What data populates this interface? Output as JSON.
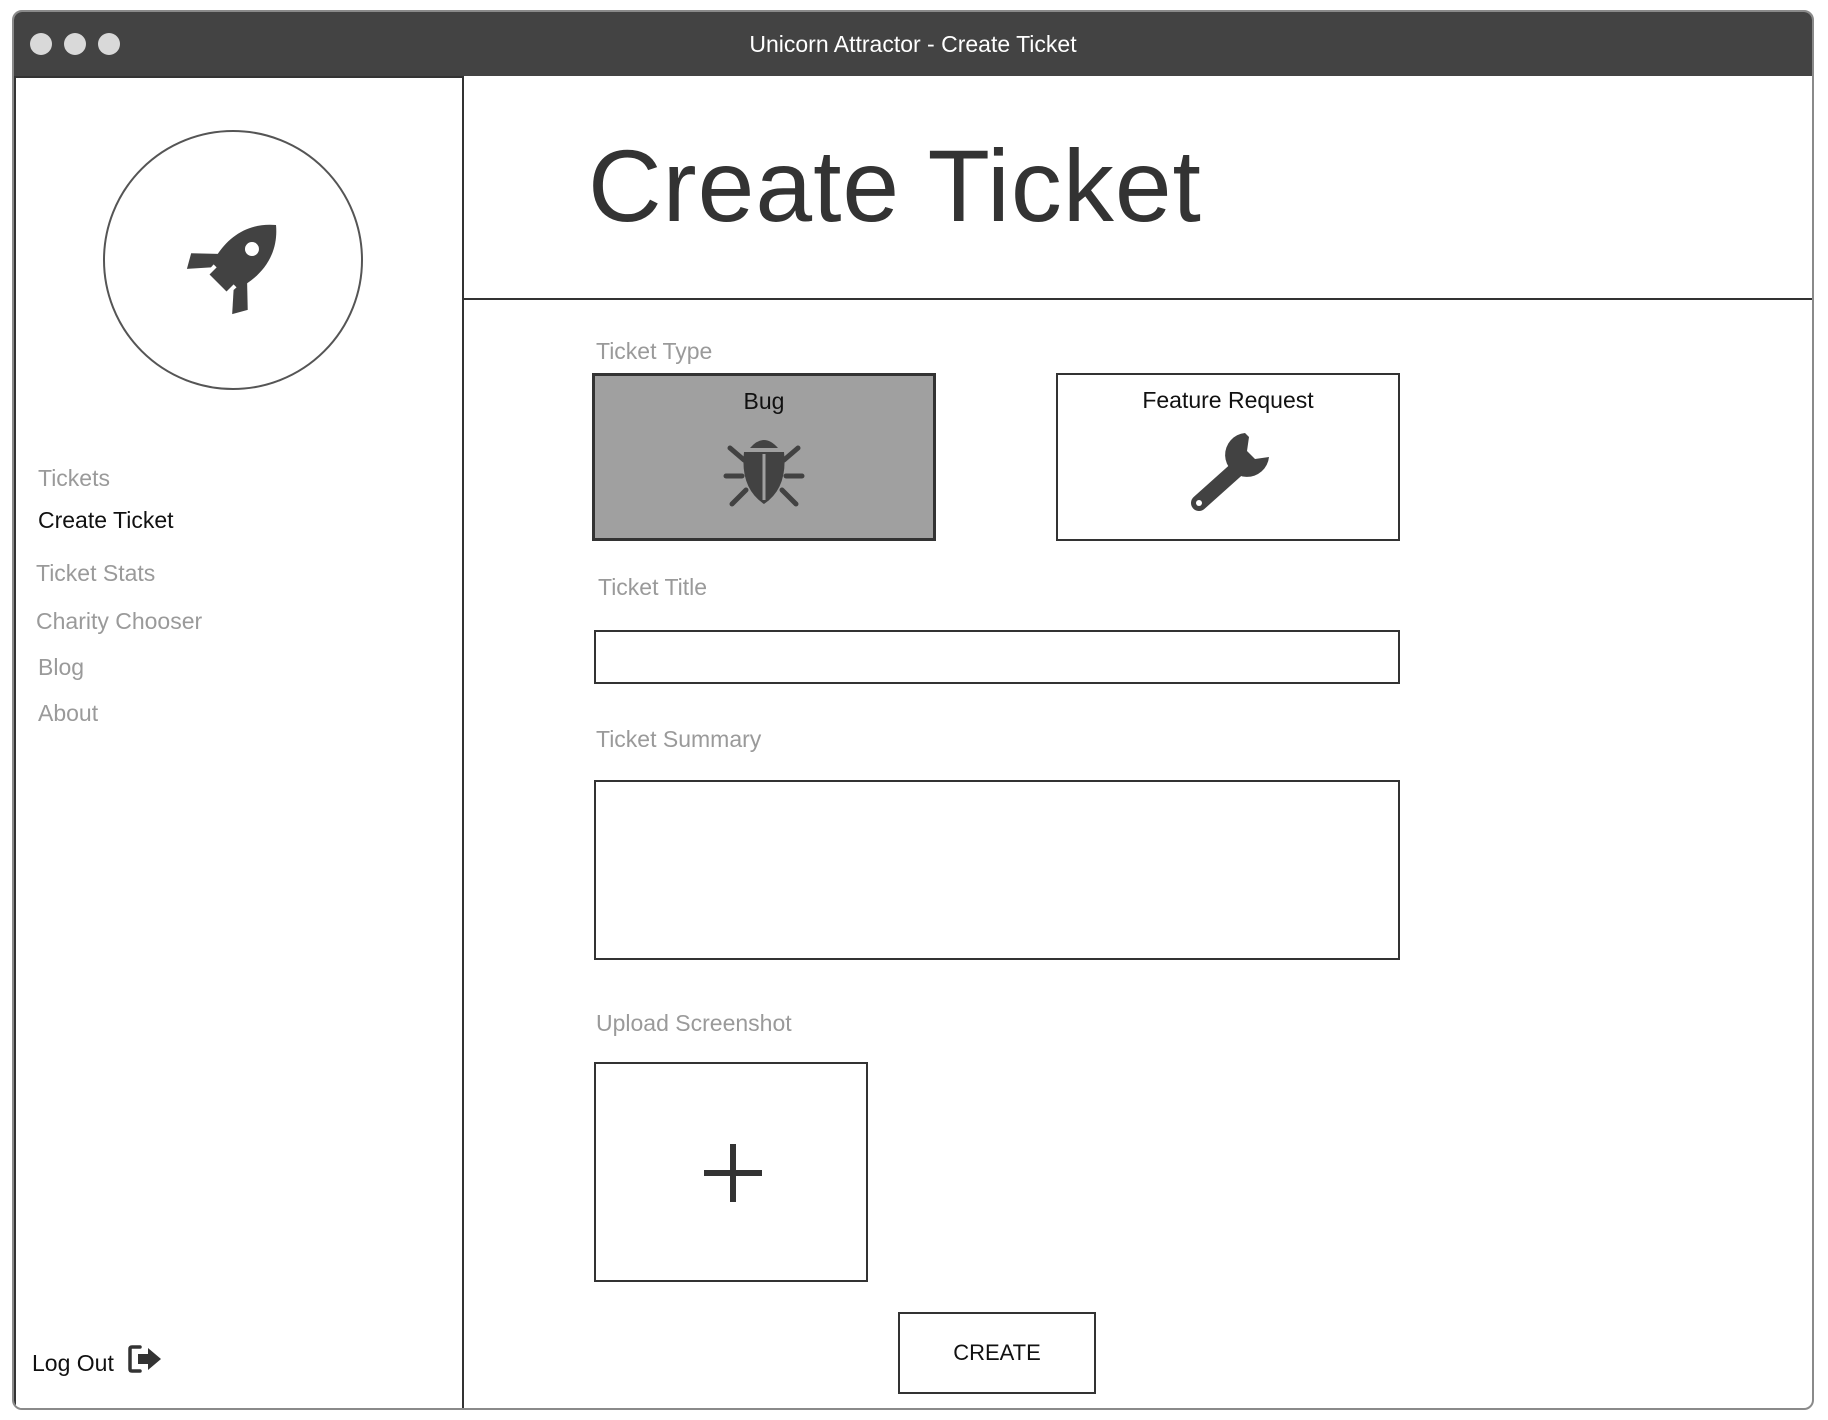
{
  "window": {
    "title": "Unicorn Attractor - Create Ticket"
  },
  "sidebar": {
    "logo_icon": "rocket-icon",
    "items": [
      {
        "label": "Tickets",
        "active": false
      },
      {
        "label": "Create Ticket",
        "active": true
      },
      {
        "label": "Ticket Stats",
        "active": false
      },
      {
        "label": "Charity Chooser",
        "active": false
      },
      {
        "label": "Blog",
        "active": false
      },
      {
        "label": "About",
        "active": false
      }
    ],
    "logout_label": "Log Out",
    "logout_icon": "sign-out-icon"
  },
  "main": {
    "title": "Create Ticket",
    "ticket_type": {
      "label": "Ticket Type",
      "options": [
        {
          "label": "Bug",
          "icon": "bug-icon",
          "selected": true
        },
        {
          "label": "Feature Request",
          "icon": "wrench-icon",
          "selected": false
        }
      ]
    },
    "ticket_title": {
      "label": "Ticket Title",
      "value": "",
      "placeholder": ""
    },
    "ticket_summary": {
      "label": "Ticket Summary",
      "value": "",
      "placeholder": ""
    },
    "upload": {
      "label": "Upload Screenshot",
      "icon": "plus-icon"
    },
    "create_label": "CREATE"
  },
  "colors": {
    "titlebar": "#434343",
    "selected_card": "#a0a0a0",
    "muted_text": "#9a9a9a",
    "dark": "#333333"
  }
}
